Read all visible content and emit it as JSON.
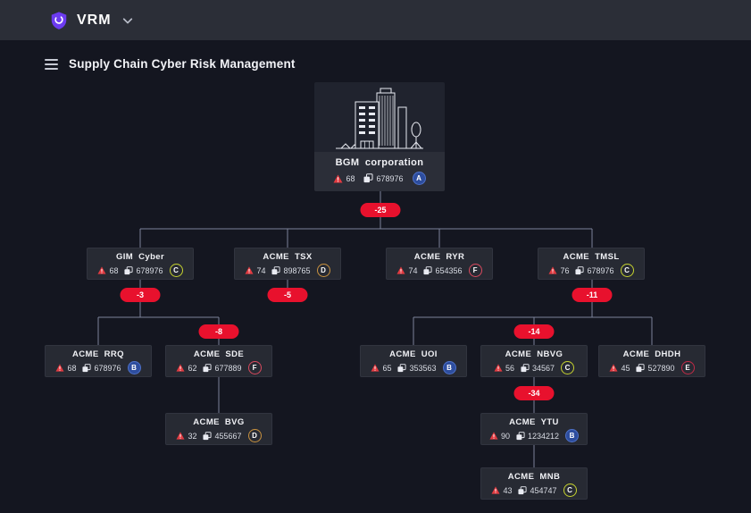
{
  "topbar": {
    "brand": "VRM"
  },
  "header": {
    "title": "Supply Chain Cyber Risk Management"
  },
  "colors": {
    "background": "#141620",
    "topbar": "#2B2E37",
    "node_background": "#272A33",
    "brand_purple": "#6C3BF0",
    "pill_red": "#E8112D",
    "warning_red": "#E23B41",
    "connector_line": "#8E96B0",
    "grade_ab_blue": "#2D4D9E",
    "grade_c_yellow": "#C6D32F",
    "grade_d_orange": "#C9923F",
    "grade_e_crimson": "#C22B47",
    "grade_f_red": "#D94A5E"
  },
  "tree": {
    "root": {
      "label": "BGM corporation",
      "warnings": "68",
      "assets": "678976",
      "grade": "A"
    },
    "pills": {
      "root": "-25",
      "gim_cyber": "-3",
      "acme_tsx": "-5",
      "acme_tmsl": "-11",
      "acme_sde": "-8",
      "acme_nbvg": "-14",
      "acme_ytu": "-34"
    },
    "nodes": {
      "gim_cyber": {
        "label": "GIM Cyber",
        "parent": "BGM corporation",
        "warnings": "68",
        "assets": "678976",
        "grade": "C"
      },
      "acme_tsx": {
        "label": "ACME TSX",
        "parent": "BGM corporation",
        "warnings": "74",
        "assets": "898765",
        "grade": "D"
      },
      "acme_ryr": {
        "label": "ACME RYR",
        "parent": "BGM corporation",
        "warnings": "74",
        "assets": "654356",
        "grade": "F"
      },
      "acme_tmsl": {
        "label": "ACME TMSL",
        "parent": "BGM corporation",
        "warnings": "76",
        "assets": "678976",
        "grade": "C"
      },
      "acme_rrq": {
        "label": "ACME RRQ",
        "parent": "GIM Cyber",
        "warnings": "68",
        "assets": "678976",
        "grade": "B"
      },
      "acme_sde": {
        "label": "ACME SDE",
        "parent": "GIM Cyber",
        "warnings": "62",
        "assets": "677889",
        "grade": "F"
      },
      "acme_uoi": {
        "label": "ACME UOI",
        "parent": "ACME TMSL",
        "warnings": "65",
        "assets": "353563",
        "grade": "B"
      },
      "acme_nbvg": {
        "label": "ACME NBVG",
        "parent": "ACME TMSL",
        "warnings": "56",
        "assets": "34567",
        "grade": "C"
      },
      "acme_dhdh": {
        "label": "ACME DHDH",
        "parent": "ACME TMSL",
        "warnings": "45",
        "assets": "527890",
        "grade": "E"
      },
      "acme_bvg": {
        "label": "ACME BVG",
        "parent": "ACME SDE",
        "warnings": "32",
        "assets": "455667",
        "grade": "D"
      },
      "acme_ytu": {
        "label": "ACME YTU",
        "parent": "ACME NBVG",
        "warnings": "90",
        "assets": "1234212",
        "grade": "B"
      },
      "acme_mnb": {
        "label": "ACME MNB",
        "parent": "ACME YTU",
        "warnings": "43",
        "assets": "454747",
        "grade": "C"
      }
    }
  }
}
